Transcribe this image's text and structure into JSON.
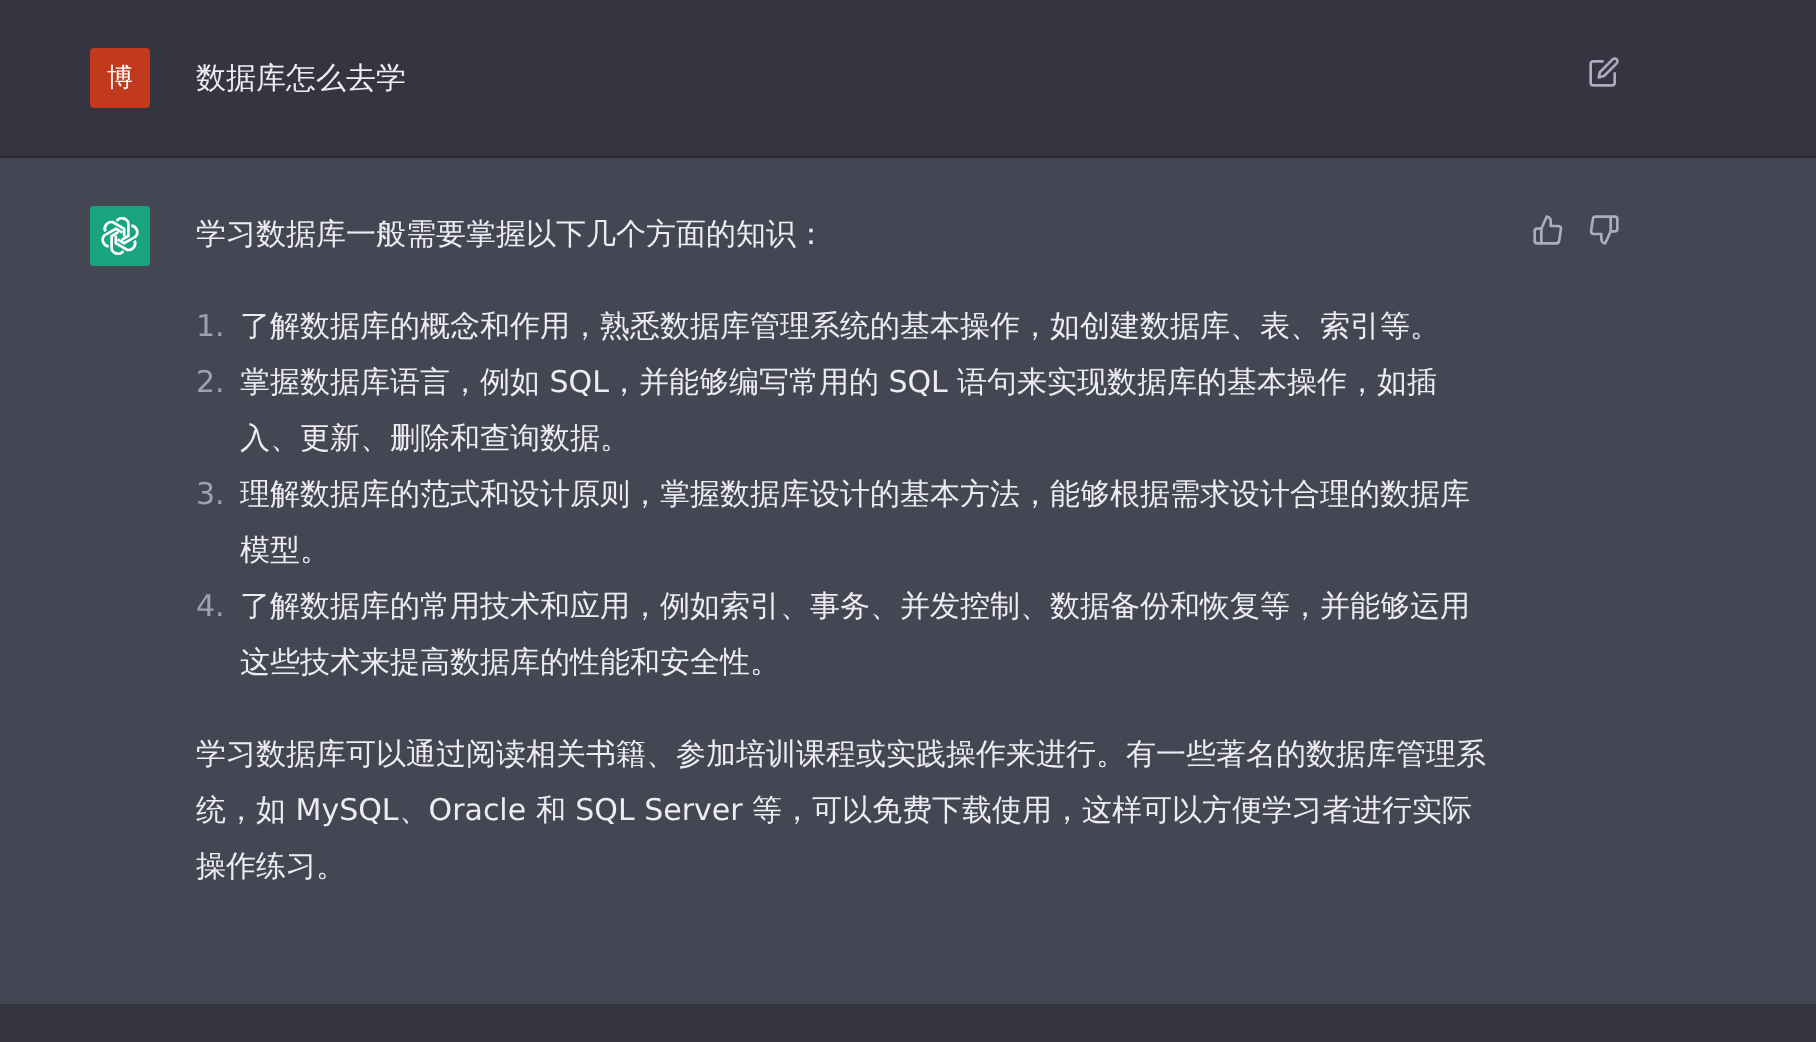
{
  "user_message": {
    "avatar": "博",
    "text": "数据库怎么去学"
  },
  "assistant_message": {
    "intro": "学习数据库一般需要掌握以下几个方面的知识：",
    "list": [
      {
        "number": "1.",
        "text": "了解数据库的概念和作用，熟悉数据库管理系统的基本操作，如创建数据库、表、索引等。"
      },
      {
        "number": "2.",
        "text": "掌握数据库语言，例如 SQL，并能够编写常用的 SQL 语句来实现数据库的基本操作，如插入、更新、删除和查询数据。"
      },
      {
        "number": "3.",
        "text": "理解数据库的范式和设计原则，掌握数据库设计的基本方法，能够根据需求设计合理的数据库模型。"
      },
      {
        "number": "4.",
        "text": "了解数据库的常用技术和应用，例如索引、事务、并发控制、数据备份和恢复等，并能够运用这些技术来提高数据库的性能和安全性。"
      }
    ],
    "conclusion": "学习数据库可以通过阅读相关书籍、参加培训课程或实践操作来进行。有一些著名的数据库管理系统，如 MySQL、Oracle 和 SQL Server 等，可以免费下载使用，这样可以方便学习者进行实际操作练习。"
  }
}
